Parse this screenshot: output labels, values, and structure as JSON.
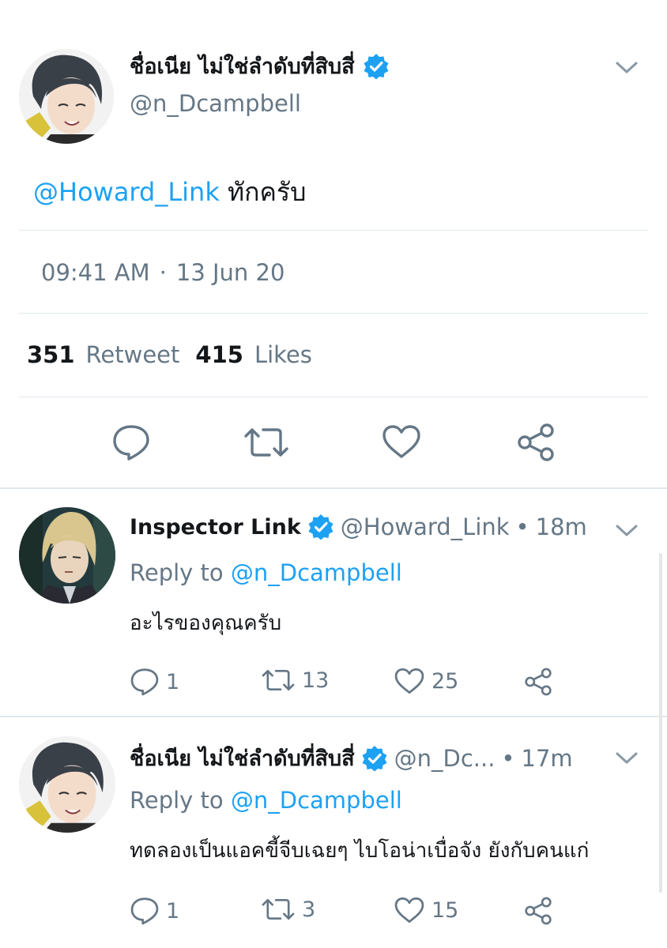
{
  "main_tweet": {
    "display_name": "ชื่อเนีย ไม่ใช่ลำดับที่สิบสี่",
    "handle": "@n_Dcampbell",
    "body_mention": "@Howard_Link",
    "body_text": "ทักครับ",
    "time": "09:41 AM",
    "dot": "·",
    "date": "13 Jun 20",
    "retweet_count": "351",
    "retweet_label": "Retweet",
    "likes_count": "415",
    "likes_label": "Likes"
  },
  "replies": [
    {
      "display_name": "Inspector Link",
      "handle": "@Howard_Link",
      "dot": "•",
      "time": "18m",
      "reply_to_label": "Reply to",
      "reply_to_mention": "@n_Dcampbell",
      "text": "อะไรของคุณครับ",
      "reply_count": "1",
      "retweet_count": "13",
      "like_count": "25"
    },
    {
      "display_name": "ชื่อเนีย ไม่ใช่ลำดับที่สิบสี่",
      "handle": "@n_Dc...",
      "dot": "•",
      "time": "17m",
      "reply_to_label": "Reply to",
      "reply_to_mention": "@n_Dcampbell",
      "text": "ทดลองเป็นแอคขี้จีบเฉยๆ ไบโอน่าเบื่อจัง ยังกับคนแก่",
      "reply_count": "1",
      "retweet_count": "3",
      "like_count": "15"
    }
  ],
  "colors": {
    "accent": "#1da1f2",
    "muted": "#657786",
    "divider": "#e1e8ed",
    "text": "#14171a"
  },
  "icons": [
    "verified-badge-icon",
    "chevron-down-icon",
    "reply-icon",
    "retweet-icon",
    "like-icon",
    "share-icon"
  ]
}
